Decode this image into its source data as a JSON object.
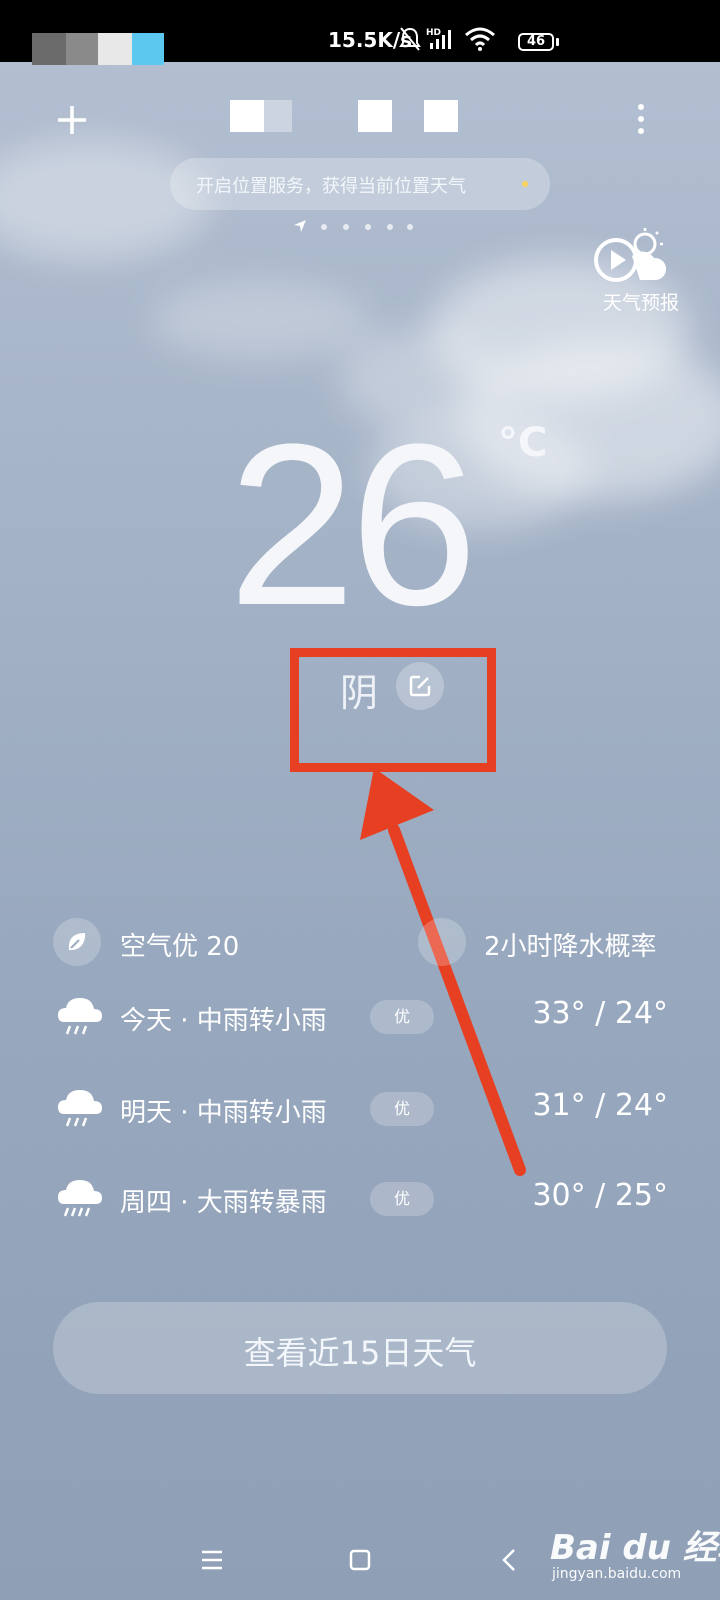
{
  "status_bar": {
    "network_speed": "15.5K/s",
    "battery_level": "46",
    "icons": [
      "mute-bell-icon",
      "hd-signal-icon",
      "wifi-icon",
      "battery-icon"
    ]
  },
  "header": {
    "add_icon": "plus-icon",
    "more_icon": "more-vertical-icon"
  },
  "location_banner": {
    "text": "开启位置服务，获得当前位置天气"
  },
  "forecast_video": {
    "label": "天气预报",
    "icon": "play-cloud-icon"
  },
  "current": {
    "temperature": "26",
    "unit": "°C",
    "condition": "阴",
    "edit_icon": "edit-icon"
  },
  "metrics": {
    "air_quality": "空气优 20",
    "rain_probability": "2小时降水概率"
  },
  "forecast": [
    {
      "day": "今天 · 中雨转小雨",
      "aqi": "优",
      "temps": "33° / 24°",
      "icon": "rain-cloud-icon"
    },
    {
      "day": "明天 · 中雨转小雨",
      "aqi": "优",
      "temps": "31° / 24°",
      "icon": "rain-cloud-icon"
    },
    {
      "day": "周四 · 大雨转暴雨",
      "aqi": "优",
      "temps": "30° / 25°",
      "icon": "heavy-rain-cloud-icon"
    }
  ],
  "cta": {
    "label": "查看近15日天气"
  },
  "watermark": {
    "logo": "Bai du 经验",
    "url": "jingyan.baidu.com"
  },
  "colors": {
    "annotation": "#e63f22",
    "sky_top": "#b4c0d2",
    "sky_bottom": "#8fa0b6",
    "location_dot": "#f5d35c"
  }
}
